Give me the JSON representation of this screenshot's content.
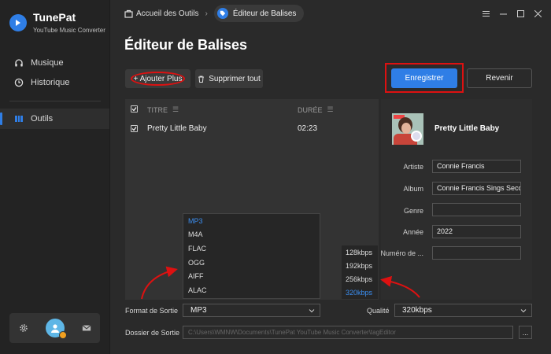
{
  "app": {
    "name": "TunePat",
    "subtitle": "YouTube Music Converter"
  },
  "sidebar": {
    "items": [
      {
        "label": "Musique",
        "icon": "headphones-icon"
      },
      {
        "label": "Historique",
        "icon": "clock-icon"
      },
      {
        "label": "Outils",
        "icon": "tools-icon",
        "active": true
      }
    ]
  },
  "breadcrumb": {
    "home": "Accueil des Outils",
    "current": "Éditeur de Balises"
  },
  "page": {
    "title": "Éditeur de Balises"
  },
  "toolbar": {
    "add_label": "+ Ajouter Plus",
    "delete_all_label": "Supprimer tout",
    "save_label": "Enregistrer",
    "back_label": "Revenir"
  },
  "table": {
    "headers": {
      "title": "TITRE",
      "duration": "DURÉE"
    },
    "rows": [
      {
        "title": "Pretty Little Baby",
        "duration": "02:23",
        "checked": true
      }
    ]
  },
  "details": {
    "cover_title": "Pretty Little Baby",
    "fields": [
      {
        "label": "Artiste",
        "value": "Connie Francis"
      },
      {
        "label": "Album",
        "value": "Connie Francis Sings Second"
      },
      {
        "label": "Genre",
        "value": ""
      },
      {
        "label": "Année",
        "value": "2022"
      },
      {
        "label": "Numéro de ...",
        "value": ""
      }
    ]
  },
  "format_dropdown": {
    "options": [
      "MP3",
      "M4A",
      "FLAC",
      "OGG",
      "AIFF",
      "ALAC"
    ],
    "selected": "MP3"
  },
  "quality_dropdown": {
    "options": [
      "128kbps",
      "192kbps",
      "256kbps",
      "320kbps"
    ],
    "selected": "320kbps"
  },
  "output": {
    "format_label": "Format de Sortie",
    "format_value": "MP3",
    "quality_label": "Qualité",
    "quality_value": "320kbps",
    "folder_label": "Dossier de Sortie",
    "folder_path": "C:\\Users\\WMNW\\Documents\\TunePat YouTube Music Converter\\tagEditor",
    "folder_button": "..."
  },
  "colors": {
    "accent": "#2f7ee6",
    "highlight": "#dd1111",
    "selected_option": "#3b8ef0"
  }
}
